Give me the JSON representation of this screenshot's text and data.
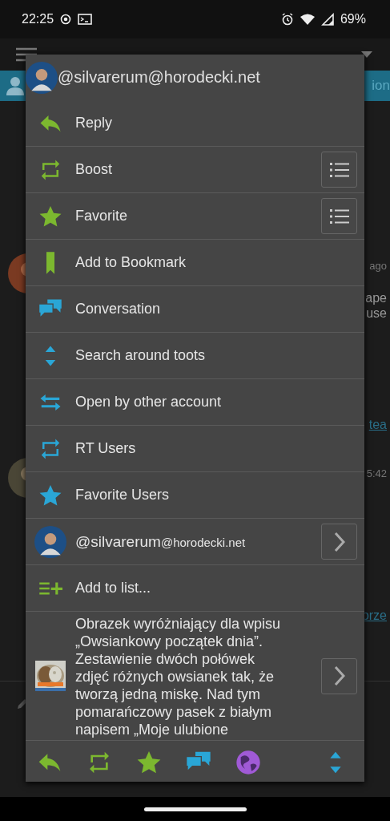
{
  "status_bar": {
    "time": "22:25",
    "battery": "69%"
  },
  "tab_bar": {
    "label": "ion"
  },
  "feed": {
    "texts": [
      {
        "text": "ago",
        "kind": "meta"
      },
      {
        "text": "ape",
        "kind": "body"
      },
      {
        "text": "use",
        "kind": "body"
      },
      {
        "text": "tea",
        "kind": "link"
      },
      {
        "text": "5:42",
        "kind": "meta"
      },
      {
        "text": "orze",
        "kind": "link"
      }
    ]
  },
  "menu": {
    "header": "@silvarerum@horodecki.net",
    "items": [
      {
        "kind": "reply",
        "label": "Reply"
      },
      {
        "kind": "boost",
        "label": "Boost",
        "options_button": true
      },
      {
        "kind": "star",
        "label": "Favorite",
        "options_button": true
      },
      {
        "kind": "bookmark",
        "label": "Add to Bookmark"
      },
      {
        "kind": "conversation",
        "label": "Conversation"
      },
      {
        "kind": "around",
        "label": "Search around toots"
      },
      {
        "kind": "switch",
        "label": "Open by other account"
      },
      {
        "kind": "rtusers",
        "label": "RT Users"
      },
      {
        "kind": "favusers",
        "label": "Favorite Users"
      },
      {
        "kind": "account",
        "label": "@silvarerum",
        "host": "@horodecki.net",
        "open_button": true
      },
      {
        "kind": "addlist",
        "label": "Add to list..."
      },
      {
        "kind": "preview",
        "label": "Obrazek wyróżniający dla wpisu „Owsiankowy początek dnia”. Zestawienie dwóch połówek zdjęć różnych owsianek tak, że tworzą jedną miskę. Nad tym pomarańczowy pasek z białym napisem „Moje ulubione",
        "open_button": true
      }
    ],
    "toolbar": [
      {
        "kind": "reply"
      },
      {
        "kind": "boost"
      },
      {
        "kind": "star"
      },
      {
        "kind": "conversation"
      },
      {
        "kind": "globe"
      },
      {
        "kind": "around"
      }
    ]
  }
}
